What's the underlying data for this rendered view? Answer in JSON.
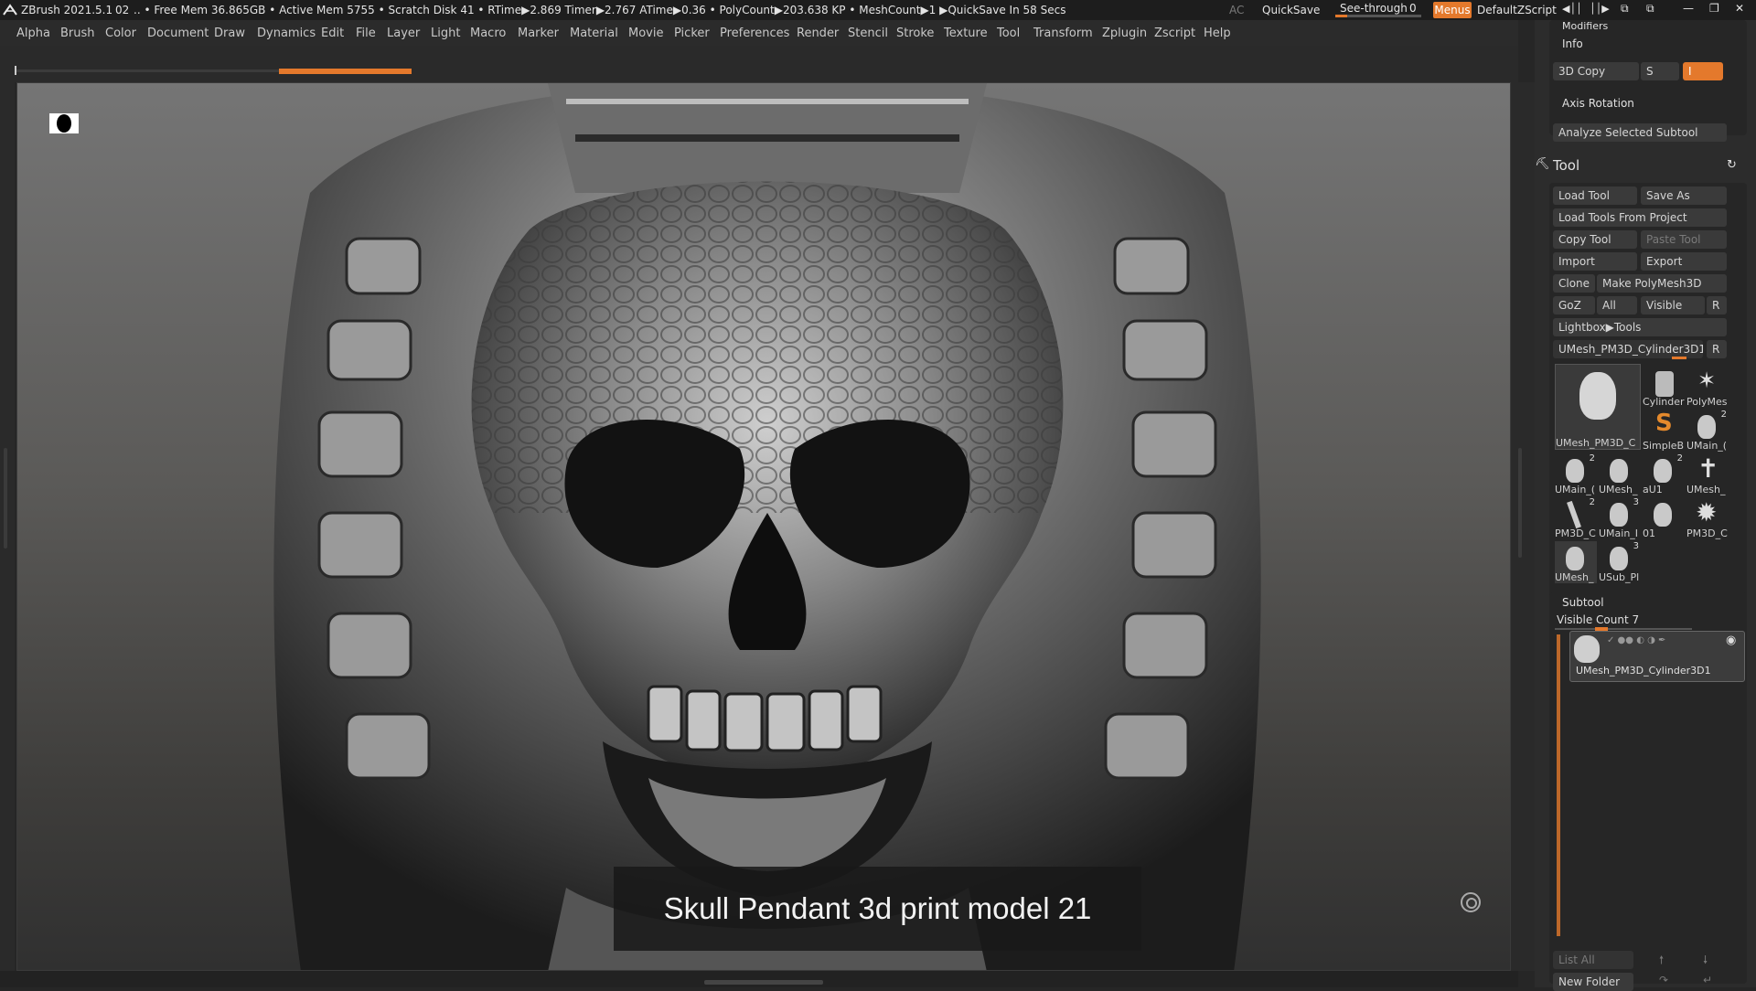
{
  "titlebar": {
    "app": "ZBrush 2021.5.1",
    "doc_num": "02",
    "stats": "..  • Free Mem 36.865GB • Active Mem 5755 • Scratch Disk 41 •  RTime▶2.869 Timer▶2.767 ATime▶0.36 • PolyCount▶203.638 KP  • MeshCount▶1  ▶QuickSave In 58 Secs",
    "ac": "AC",
    "quicksave": "QuickSave",
    "see_through": "See-through",
    "see_through_value": "0",
    "see_through_fraction": 0.14,
    "menus": "Menus",
    "default_zscript": "DefaultZScript"
  },
  "menu": [
    "Alpha",
    "Brush",
    "Color",
    "Document",
    "Draw",
    "Dynamics",
    "Edit",
    "File",
    "Layer",
    "Light",
    "Macro",
    "Marker",
    "Material",
    "Movie",
    "Picker",
    "Preferences",
    "Render",
    "Stencil",
    "Stroke",
    "Texture",
    "Tool",
    "Transform",
    "Zplugin",
    "Zscript",
    "Help"
  ],
  "caption": "Skull Pendant 3d print model 21",
  "panel": {
    "modifiers": "Modifiers",
    "info": "Info",
    "copy3d": "3D Copy",
    "s_label": "S",
    "i_label": "I",
    "axis_rotation": "Axis Rotation",
    "analyze": "Analyze Selected Subtool",
    "tool_title": "Tool",
    "load_tool": "Load Tool",
    "save_as": "Save As",
    "load_tools_project": "Load Tools From Project",
    "copy_tool": "Copy Tool",
    "paste_tool": "Paste Tool",
    "import": "Import",
    "export": "Export",
    "clone": "Clone",
    "make_polymesh": "Make PolyMesh3D",
    "goz": "GoZ",
    "all": "All",
    "visible": "Visible",
    "r": "R",
    "lightbox_tools": "Lightbox▶Tools",
    "current_tool": "UMesh_PM3D_Cylinder3D1",
    "main_thumb_label": "UMesh_PM3D_C",
    "thumbs": [
      {
        "label": "Cylinder",
        "count": ""
      },
      {
        "label": "PolyMes",
        "count": ""
      },
      {
        "label": "SimpleB",
        "count": ""
      },
      {
        "label": "UMain_(",
        "count": "2"
      },
      {
        "label": "UMain_(",
        "count": "2"
      },
      {
        "label": "UMesh_",
        "count": ""
      },
      {
        "label": "aU1",
        "count": "2"
      },
      {
        "label": "UMesh_",
        "count": ""
      },
      {
        "label": "PM3D_C",
        "count": "2"
      },
      {
        "label": "UMain_I",
        "count": "3"
      },
      {
        "label": "01",
        "count": ""
      },
      {
        "label": "PM3D_C",
        "count": ""
      },
      {
        "label": "UMesh_",
        "count": ""
      },
      {
        "label": "USub_Pl",
        "count": "3"
      }
    ],
    "subtool_title": "Subtool",
    "visible_count": "Visible Count 7",
    "subtool_name": "UMesh_PM3D_Cylinder3D1",
    "list_all": "List All",
    "new_folder": "New Folder"
  }
}
